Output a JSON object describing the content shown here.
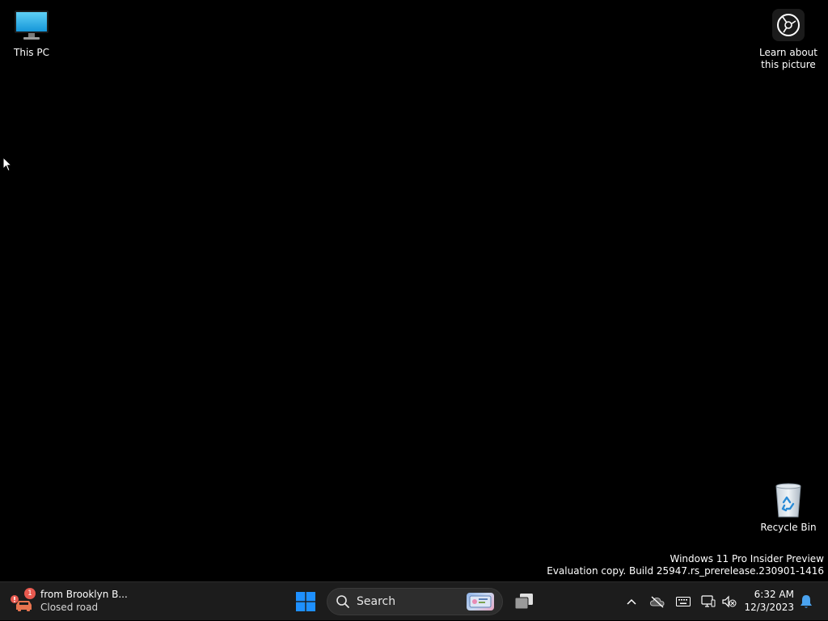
{
  "desktop": {
    "icons": [
      {
        "id": "this-pc",
        "label": "This PC"
      },
      {
        "id": "learn",
        "label": "Learn about\nthis picture"
      },
      {
        "id": "recycle",
        "label": "Recycle Bin"
      }
    ],
    "watermark": {
      "line1": "Windows 11 Pro Insider Preview",
      "line2": "Evaluation copy. Build 25947.rs_prerelease.230901-1416"
    }
  },
  "taskbar": {
    "news": {
      "badge": "1",
      "title": "from Brooklyn B...",
      "subtitle": "Closed road",
      "icon": "traffic-alert-icon",
      "accent": "#e8594f"
    },
    "start": {
      "icon": "windows-start-icon",
      "color": "#1e90ff"
    },
    "search": {
      "label": "Search",
      "icon": "search-icon"
    },
    "taskview": {
      "icon": "task-view-icon"
    },
    "tray": {
      "chevron": "chevron-up-icon",
      "onedrive": "onedrive-offline-icon",
      "keyboard": "keyboard-icon",
      "network": "network-icon",
      "volume": "volume-muted-icon",
      "bell": "notification-bell-icon"
    },
    "clock": {
      "time": "6:32 AM",
      "date": "12/3/2023"
    }
  }
}
